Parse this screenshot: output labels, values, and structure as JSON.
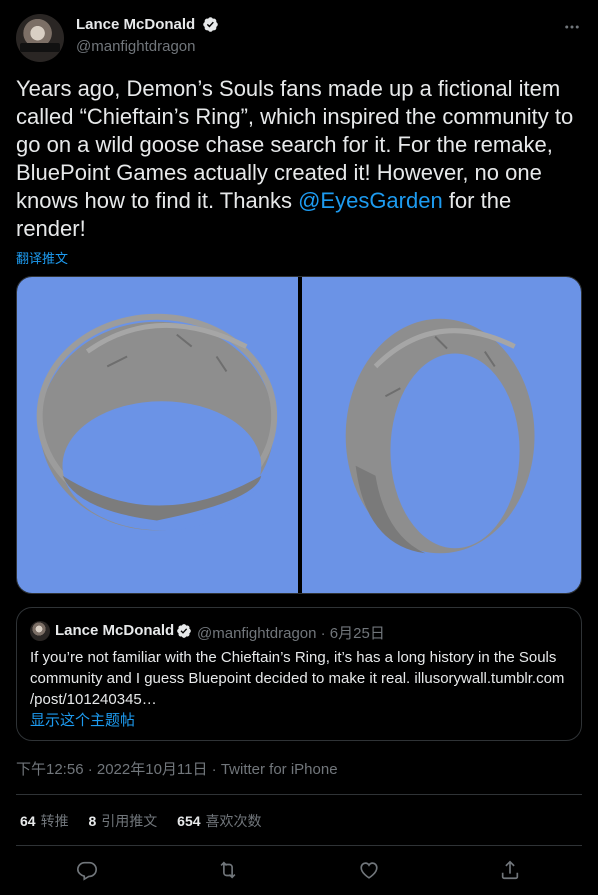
{
  "header": {
    "display_name": "Lance McDonald",
    "handle": "@manfightdragon"
  },
  "tweet": {
    "text_before_mention": "Years ago, Demon’s Souls fans made up a fictional item called “Chieftain’s Ring”, which inspired the community to go on a wild goose chase search for it. For the remake, BluePoint Games actually created it! However, no one knows how to find it. Thanks ",
    "mention": "@EyesGarden",
    "text_after_mention": " for the render!",
    "translate_label": "翻译推文"
  },
  "quote": {
    "display_name": "Lance McDonald",
    "handle_date": "@manfightdragon · 6月25日",
    "text": "If you’re not familiar with the Chieftain’s Ring, it’s has a long history in the Souls community and I guess Bluepoint decided to make it real. illusorywall.tumblr.com /post/101240345…",
    "show_thread": "显示这个主题帖"
  },
  "timestamp": "下午12:56 · 2022年10月11日 · Twitter for iPhone",
  "stats": [
    {
      "count": "64",
      "label": "转推"
    },
    {
      "count": "8",
      "label": "引用推文"
    },
    {
      "count": "654",
      "label": "喜欢次数"
    }
  ],
  "icons": {
    "verified": "verified-badge-icon",
    "more": "more-icon",
    "reply": "reply-icon",
    "retweet": "retweet-icon",
    "like": "heart-icon",
    "share": "share-icon"
  },
  "colors": {
    "background": "#000000",
    "text": "#e7e9ea",
    "secondary": "#71767b",
    "accent": "#1d9bf0",
    "image_bg": "#6b93e6",
    "ring": "#8a8a8a"
  }
}
